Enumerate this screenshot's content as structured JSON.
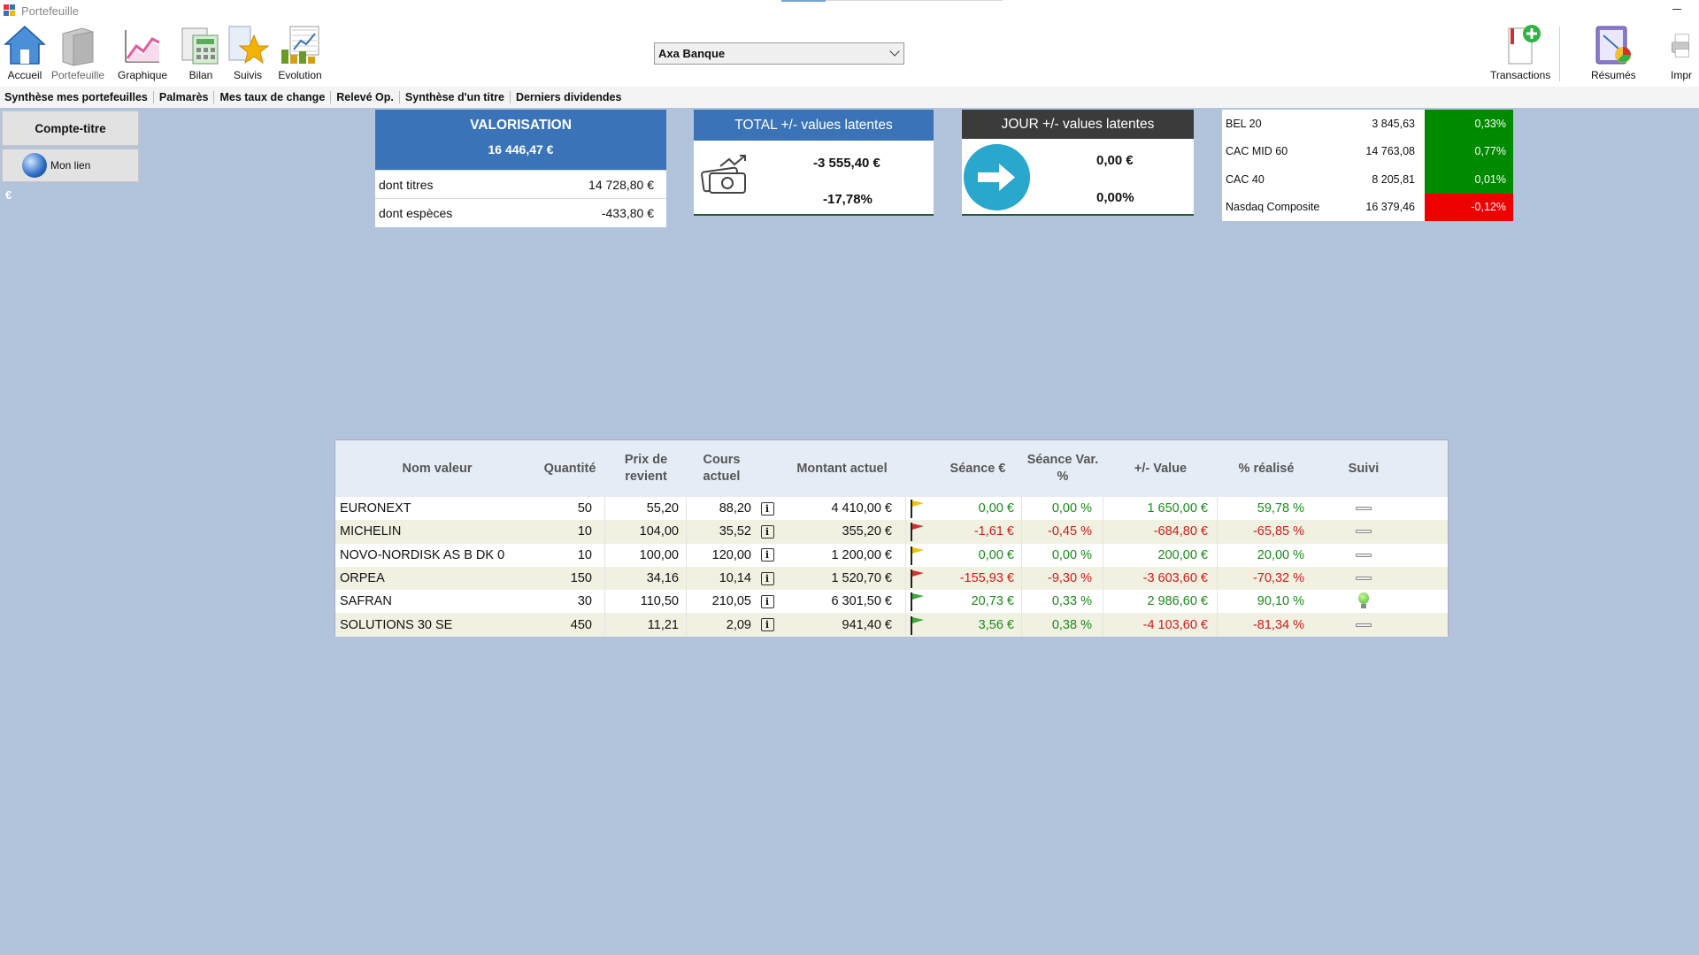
{
  "window": {
    "title": "Portefeuille"
  },
  "ribbon": {
    "buttons": [
      {
        "label": "Accueil",
        "icon": "home-icon"
      },
      {
        "label": "Portefeuille",
        "icon": "wallet-icon"
      },
      {
        "label": "Graphique",
        "icon": "chart-icon"
      },
      {
        "label": "Bilan",
        "icon": "calculator-icon"
      },
      {
        "label": "Suivis",
        "icon": "star-icon"
      },
      {
        "label": "Evolution",
        "icon": "evolution-icon"
      }
    ],
    "account_select": "Axa Banque",
    "right_buttons": [
      {
        "label": "Transactions",
        "icon": "add-transaction-icon"
      },
      {
        "label": "Résumés",
        "icon": "summary-icon"
      },
      {
        "label": "Impr",
        "icon": "printer-icon"
      }
    ]
  },
  "menu": [
    "Synthèse mes portefeuilles",
    "Palmarès",
    "Mes taux de change",
    "Relevé Op.",
    "Synthèse d'un titre",
    "Derniers dividendes"
  ],
  "sidebar": {
    "compte_titre": "Compte-titre",
    "link": "Mon lien",
    "currency": "€"
  },
  "valorisation": {
    "title": "VALORISATION",
    "total": "16 446,47 €",
    "rows": [
      {
        "label": "dont titres",
        "value": "14 728,80 €"
      },
      {
        "label": "dont espèces",
        "value": "-433,80 €"
      }
    ]
  },
  "total_latent": {
    "title": "TOTAL +/- values latentes",
    "amount": "-3 555,40 €",
    "percent": "-17,78%"
  },
  "jour_latent": {
    "title": "JOUR +/- values latentes",
    "amount": "0,00 €",
    "percent": "0,00%"
  },
  "indices": [
    {
      "name": "BEL 20",
      "value": "3 845,63",
      "change": "0,33%",
      "color": "#008a00"
    },
    {
      "name": "CAC MID 60",
      "value": "14 763,08",
      "change": "0,77%",
      "color": "#008a00"
    },
    {
      "name": "CAC 40",
      "value": "8 205,81",
      "change": "0,01%",
      "color": "#008a00"
    },
    {
      "name": "Nasdaq Composite",
      "value": "16 379,46",
      "change": "-0,12%",
      "color": "#ee0000"
    }
  ],
  "table": {
    "headers": {
      "name": "Nom valeur",
      "qty": "Quantité",
      "prix": "Prix de revient",
      "cours": "Cours actuel",
      "montant": "Montant actuel",
      "seance": "Séance €",
      "var": "Séance Var. %",
      "pv": "+/- Value",
      "real": "% réalisé",
      "suivi": "Suivi"
    },
    "rows": [
      {
        "name": "EURONEXT",
        "qty": "50",
        "prix": "55,20",
        "cours": "88,20",
        "montant": "4 410,00 €",
        "flag": "yellow",
        "seance": "0,00 €",
        "var": "0,00 %",
        "pv": "1 650,00 €",
        "real": "59,78 %",
        "suivi": "dash"
      },
      {
        "name": "MICHELIN",
        "qty": "10",
        "prix": "104,00",
        "cours": "35,52",
        "montant": "355,20 €",
        "flag": "red",
        "seance": "-1,61 €",
        "var": "-0,45 %",
        "pv": "-684,80 €",
        "real": "-65,85 %",
        "suivi": "dash"
      },
      {
        "name": "NOVO-NORDISK AS B  DK 0",
        "qty": "10",
        "prix": "100,00",
        "cours": "120,00",
        "montant": "1 200,00 €",
        "flag": "yellow",
        "seance": "0,00 €",
        "var": "0,00 %",
        "pv": "200,00 €",
        "real": "20,00 %",
        "suivi": "dash"
      },
      {
        "name": "ORPEA",
        "qty": "150",
        "prix": "34,16",
        "cours": "10,14",
        "montant": "1 520,70 €",
        "flag": "red",
        "seance": "-155,93 €",
        "var": "-9,30 %",
        "pv": "-3 603,60 €",
        "real": "-70,32 %",
        "suivi": "dash"
      },
      {
        "name": "SAFRAN",
        "qty": "30",
        "prix": "110,50",
        "cours": "210,05",
        "montant": "6 301,50 €",
        "flag": "green",
        "seance": "20,73 €",
        "var": "0,33 %",
        "pv": "2 986,60 €",
        "real": "90,10 %",
        "suivi": "bulb"
      },
      {
        "name": "SOLUTIONS 30 SE",
        "qty": "450",
        "prix": "11,21",
        "cours": "2,09",
        "montant": "941,40 €",
        "flag": "green",
        "seance": "3,56 €",
        "var": "0,38 %",
        "pv": "-4 103,60 €",
        "real": "-81,34 %",
        "suivi": "dash"
      }
    ]
  }
}
